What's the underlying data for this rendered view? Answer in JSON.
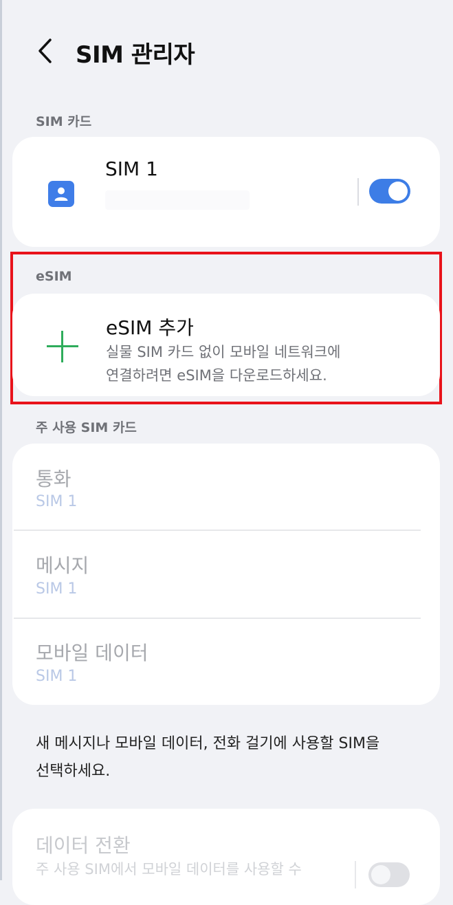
{
  "header": {
    "title": "SIM 관리자",
    "back_icon": "chevron-left-icon"
  },
  "sections": {
    "sim_cards": "SIM 카드",
    "esim": "eSIM",
    "primary": "주 사용 SIM 카드"
  },
  "sim1": {
    "name": "SIM 1",
    "enabled": true,
    "icon": "sim-card-person-icon",
    "accent": "#3d7de6"
  },
  "esim_add": {
    "title": "eSIM 추가",
    "line1": "실물 SIM 카드 없이 모바일 네트워크에",
    "line2": "연결하려면 eSIM을 다운로드하세요.",
    "icon": "plus-icon",
    "icon_color": "#2eac5b"
  },
  "primary_list": [
    {
      "title": "통화",
      "value": "SIM 1"
    },
    {
      "title": "메시지",
      "value": "SIM 1"
    },
    {
      "title": "모바일 데이터",
      "value": "SIM 1"
    }
  ],
  "footer_note": {
    "line1": "새 메시지나 모바일 데이터, 전화 걸기에 사용할 SIM을",
    "line2": "선택하세요."
  },
  "data_switch": {
    "title": "데이터 전환",
    "desc": "주 사용 SIM에서 모바일 데이터를 사용할 수",
    "enabled": false
  },
  "highlight_color": "#e8131b"
}
